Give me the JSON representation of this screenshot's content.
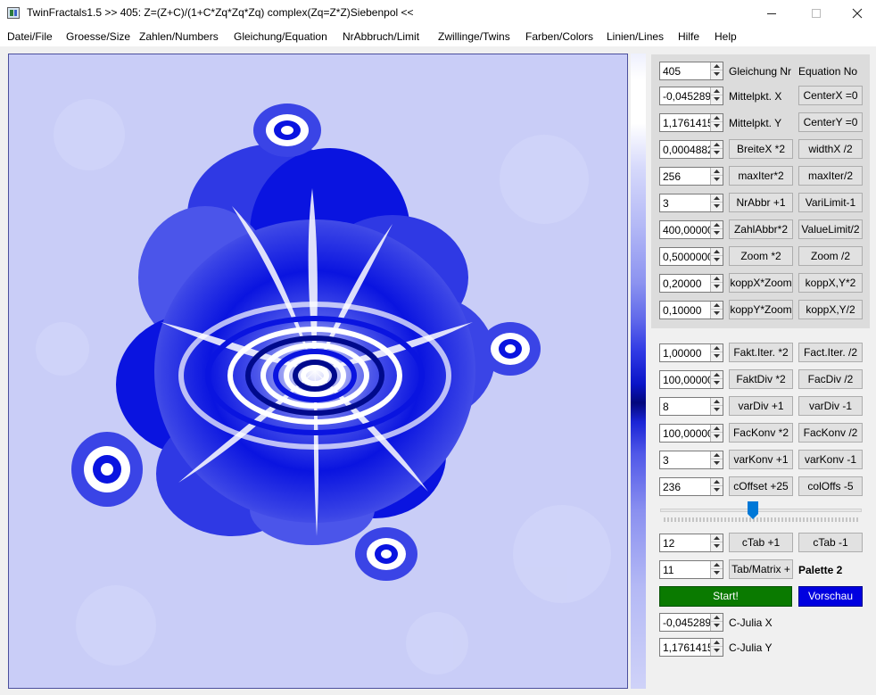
{
  "window": {
    "title": "TwinFractals1.5 >> 405: Z=(Z+C)/(1+C*Zq*Zq*Zq) complex(Zq=Z*Z)Siebenpol <<",
    "controls": [
      "minimize-icon",
      "maximize-icon",
      "close-icon"
    ]
  },
  "menu": [
    "Datei/File",
    "Groesse/Size",
    "Zahlen/Numbers",
    "Gleichung/Equation",
    "NrAbbruch/Limit",
    "Zwillinge/Twins",
    "Farben/Colors",
    "Linien/Lines",
    "Hilfe",
    "Help"
  ],
  "colors": {
    "fractal_background": "#c9cdf7",
    "fractal_primary": "#0a14e0",
    "fractal_dark": "#000a8c",
    "start_button": "#0a7a00",
    "preview_button": "#0000e0"
  },
  "params": [
    {
      "value": "405",
      "label_de": "Gleichung Nr",
      "label_en": "Equation No"
    },
    {
      "value": "-0,045289",
      "label_de": "Mittelpkt. X",
      "button": "CenterX =0"
    },
    {
      "value": "1,1761415",
      "label_de": "Mittelpkt. Y",
      "button": "CenterY =0"
    },
    {
      "value": "0,0004882",
      "button1": "BreiteX *2",
      "button2": "widthX /2"
    },
    {
      "value": "256",
      "button1": "maxIter*2",
      "button2": "maxIter/2"
    },
    {
      "value": "3",
      "button1": "NrAbbr +1",
      "button2": "VariLimit-1"
    },
    {
      "value": "400,00000",
      "button1": "ZahlAbbr*2",
      "button2": "ValueLimit/2"
    },
    {
      "value": "0,5000000",
      "button1": "Zoom *2",
      "button2": "Zoom /2"
    },
    {
      "value": "0,20000",
      "button1": "koppX*Zoom",
      "button2": "koppX,Y*2"
    },
    {
      "value": "0,10000",
      "button1": "koppY*Zoom",
      "button2": "koppX,Y/2"
    }
  ],
  "factors": [
    {
      "value": "1,00000",
      "button1": "Fakt.Iter. *2",
      "button2": "Fact.Iter. /2"
    },
    {
      "value": "100,00000",
      "button1": "FaktDiv *2",
      "button2": "FacDiv /2"
    },
    {
      "value": "8",
      "button1": "varDiv +1",
      "button2": "varDiv -1"
    },
    {
      "value": "100,00000",
      "button1": "FacKonv *2",
      "button2": "FacKonv /2"
    },
    {
      "value": "3",
      "button1": "varKonv +1",
      "button2": "varKonv -1"
    },
    {
      "value": "236",
      "button1": "cOffset +25",
      "button2": "colOffs -5"
    }
  ],
  "slider": {
    "value": 0.46
  },
  "ctab": {
    "value": "12",
    "button1": "cTab +1",
    "button2": "cTab -1"
  },
  "tabmatrix": {
    "value": "11",
    "button": "Tab/Matrix +",
    "palette_label": "Palette 2"
  },
  "actions": {
    "start": "Start!",
    "preview": "Vorschau"
  },
  "julia": [
    {
      "value": "-0,045289",
      "label": "C-Julia X"
    },
    {
      "value": "1,1761415",
      "label": "C-Julia Y"
    }
  ]
}
